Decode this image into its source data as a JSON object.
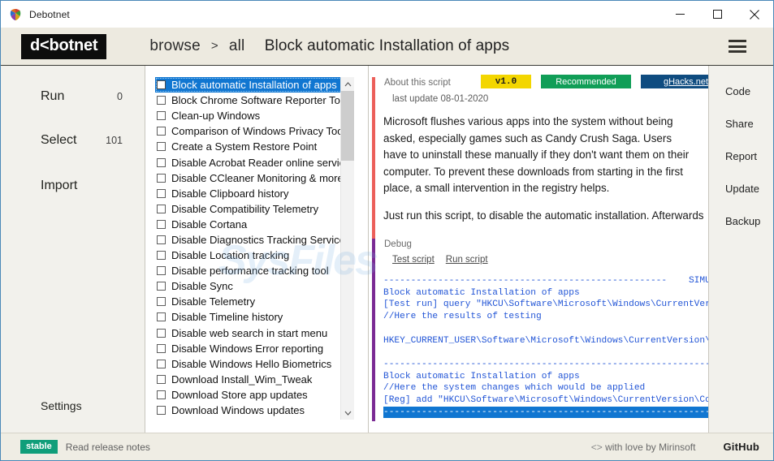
{
  "window": {
    "title": "Debotnet",
    "app_icon": "debotnet-shield-icon",
    "controls": {
      "minimize": "minimize-icon",
      "maximize": "maximize-icon",
      "close": "close-icon"
    }
  },
  "header": {
    "logo": "d<botnet",
    "breadcrumb": {
      "root": "browse",
      "separator": ">",
      "current": "all"
    },
    "title": "Block automatic Installation of apps",
    "menu_icon": "hamburger-menu-icon"
  },
  "left_nav": {
    "items": [
      {
        "label": "Run",
        "count": "0"
      },
      {
        "label": "Select",
        "count": "101"
      },
      {
        "label": "Import",
        "count": ""
      }
    ],
    "settings_label": "Settings"
  },
  "script_list": {
    "selected_index": 0,
    "scrollbar": {
      "up_arrow": "chevron-up-icon",
      "down_arrow": "chevron-down-icon"
    },
    "items": [
      "Block automatic Installation of apps",
      "Block Chrome Software Reporter Tool",
      "Clean-up Windows",
      "Comparison of Windows Privacy Tools",
      "Create a System Restore Point",
      "Disable Acrobat Reader online service",
      "Disable CCleaner Monitoring & more",
      "Disable Clipboard history",
      "Disable Compatibility Telemetry",
      "Disable Cortana",
      "Disable Diagnostics Tracking Service",
      "Disable Location tracking",
      "Disable performance tracking tool",
      "Disable Sync",
      "Disable Telemetry",
      "Disable Timeline history",
      "Disable web search in start menu",
      "Disable Windows Error reporting",
      "Disable Windows Hello Biometrics",
      "Download Install_Wim_Tweak",
      "Download Store app updates",
      "Download Windows updates"
    ]
  },
  "about": {
    "section_label": "About this script",
    "last_update": "last update 08-01-2020",
    "badges": {
      "version": "v1.0",
      "recommended": "Recommended",
      "link": "gHacks.net"
    },
    "description": "Microsoft flushes various apps into the system without being asked, especially games such as Candy Crush Saga. Users have to uninstall these manually if they don't want them on their computer. To prevent these downloads from starting in the first place, a small intervention in the registry helps.",
    "description2": "Just run this script, to disable the automatic installation. Afterwards"
  },
  "debug": {
    "section_label": "Debug",
    "test_script": "Test script",
    "run_script": "Run script",
    "output": {
      "rule_top": "----------------------------------------------------",
      "simulation_tag": "SIMULATION",
      "block1_line1": "Block automatic Installation of apps",
      "block1_line2": "[Test run] query \"HKCU\\Software\\Microsoft\\Windows\\CurrentVersion",
      "block1_line3": "//Here the results of testing",
      "block1_line4": "HKEY_CURRENT_USER\\Software\\Microsoft\\Windows\\CurrentVersion\\Cont",
      "rule_mid": "----------------------------------------------------------------",
      "block2_line1": "Block automatic Installation of apps",
      "block2_line2": "//Here the system changes which would be applied",
      "block2_line3": "[Reg] add \"HKCU\\Software\\Microsoft\\Windows\\CurrentVersion\\Conter",
      "rule_bottom": "----------------------------------------------------------------"
    }
  },
  "right_nav": {
    "items": [
      "Code",
      "Share",
      "Report",
      "Update",
      "Backup"
    ]
  },
  "status_bar": {
    "channel": "stable",
    "release_notes": "Read release notes",
    "made_with": "with love by Mirinsoft",
    "code_arrows": "<>",
    "github": "GitHub"
  },
  "watermark": "SysFiles",
  "colors": {
    "accent_blue": "#1076d1",
    "badge_yellow": "#f3d600",
    "badge_green": "#109e57",
    "badge_blue": "#0f4c80",
    "accent_red": "#ec5f5a",
    "accent_purple": "#7b2a94",
    "chip_teal": "#109e7a",
    "code_blue": "#2255d6"
  }
}
